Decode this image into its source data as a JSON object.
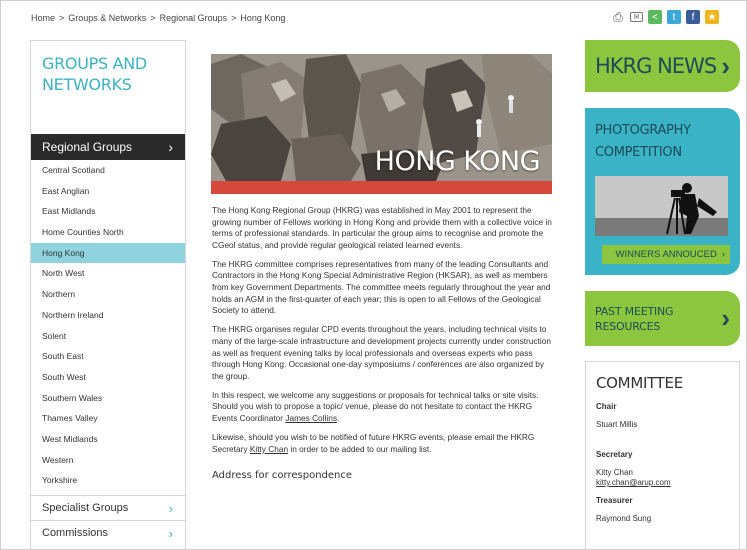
{
  "breadcrumb": [
    "Home",
    "Groups & Networks",
    "Regional Groups",
    "Hong Kong"
  ],
  "breadcrumb_separator": ">",
  "share_icons": [
    "print-icon",
    "email-icon",
    "sharethis-icon",
    "twitter-icon",
    "facebook-icon",
    "bookmark-icon"
  ],
  "sidebar": {
    "title": "GROUPS AND NETWORKS",
    "regional_header": "Regional Groups",
    "regional_items": [
      "Central Scotland",
      "East Anglian",
      "East Midlands",
      "Home Counties North",
      "Hong Kong",
      "North West",
      "Northern",
      "Northern Ireland",
      "Solent",
      "South East",
      "South West",
      "Southern Wales",
      "Thames Valley",
      "West Midlands",
      "Western",
      "Yorkshire"
    ],
    "active_item": "Hong Kong",
    "specialist_label": "Specialist Groups",
    "commissions_label": "Commissions"
  },
  "hero": {
    "title": "HONG KONG"
  },
  "content": {
    "p1": "The Hong Kong Regional Group (HKRG) was established in May 2001 to represent the growing number of Fellows working in Hong Kong and provide them with a collective voice in terms of professional standards. In particular the group aims to recognise and promote the CGeol status, and provide regular geological related learned events.",
    "p2": "The HKRG committee comprises representatives from many of the leading Consultants and Contractors in the Hong Kong Special Administrative Region (HKSAR), as well as members from key Government Departments. The committee meets regularly throughout the year and holds an AGM in the first-quarter of each year; this is open to all Fellows of the Geological Society to attend.",
    "p3": "The HKRG organises regular CPD events throughout the years, including technical visits to many of the large-scale infrastructure and development projects currently under construction as well as frequent evening talks by local professionals and overseas experts who pass through Hong Kong. Occasional one-day symposiums / conferences are also organized by the group.",
    "p4_pre": "In this respect, we welcome any suggestions or proposals for technical talks or site visits. Should you wish to propose a topic/ venue, please do not hesitate to contact the HKRG Events Coordinator ",
    "p4_link": "James Collins",
    "p4_post": ".",
    "p5_pre": "Likewise, should you wish to be notified of future HKRG events, please email the HKRG Secretary ",
    "p5_link": "Kitty Chan",
    "p5_post": " in order to be added to our mailing list.",
    "address_heading": "Address for correspondence"
  },
  "right": {
    "news_label": "HKRG NEWS",
    "photo_label_1": "PHOTOGRAPHY",
    "photo_label_2": "COMPETITION",
    "winners_label": "WINNERS ANNOUCED",
    "past_label_1": "PAST MEETING",
    "past_label_2": "RESOURCES",
    "committee_title": "COMMITTEE",
    "chair_role": "Chair",
    "chair_name": "Stuart Millis",
    "secretary_role": "Secretary",
    "secretary_name": "Kitty Chan",
    "secretary_email": "kitty.chan@arup.com",
    "treasurer_role": "Treasurer",
    "treasurer_name": "Raymond Sung"
  },
  "colors": {
    "teal": "#3bb3c6",
    "green": "#8cc63f",
    "dark_teal_text": "#1e4b57",
    "red_bar": "#d4493c",
    "active_bg": "#8fd3df",
    "dark_header": "#2a2a2a"
  }
}
